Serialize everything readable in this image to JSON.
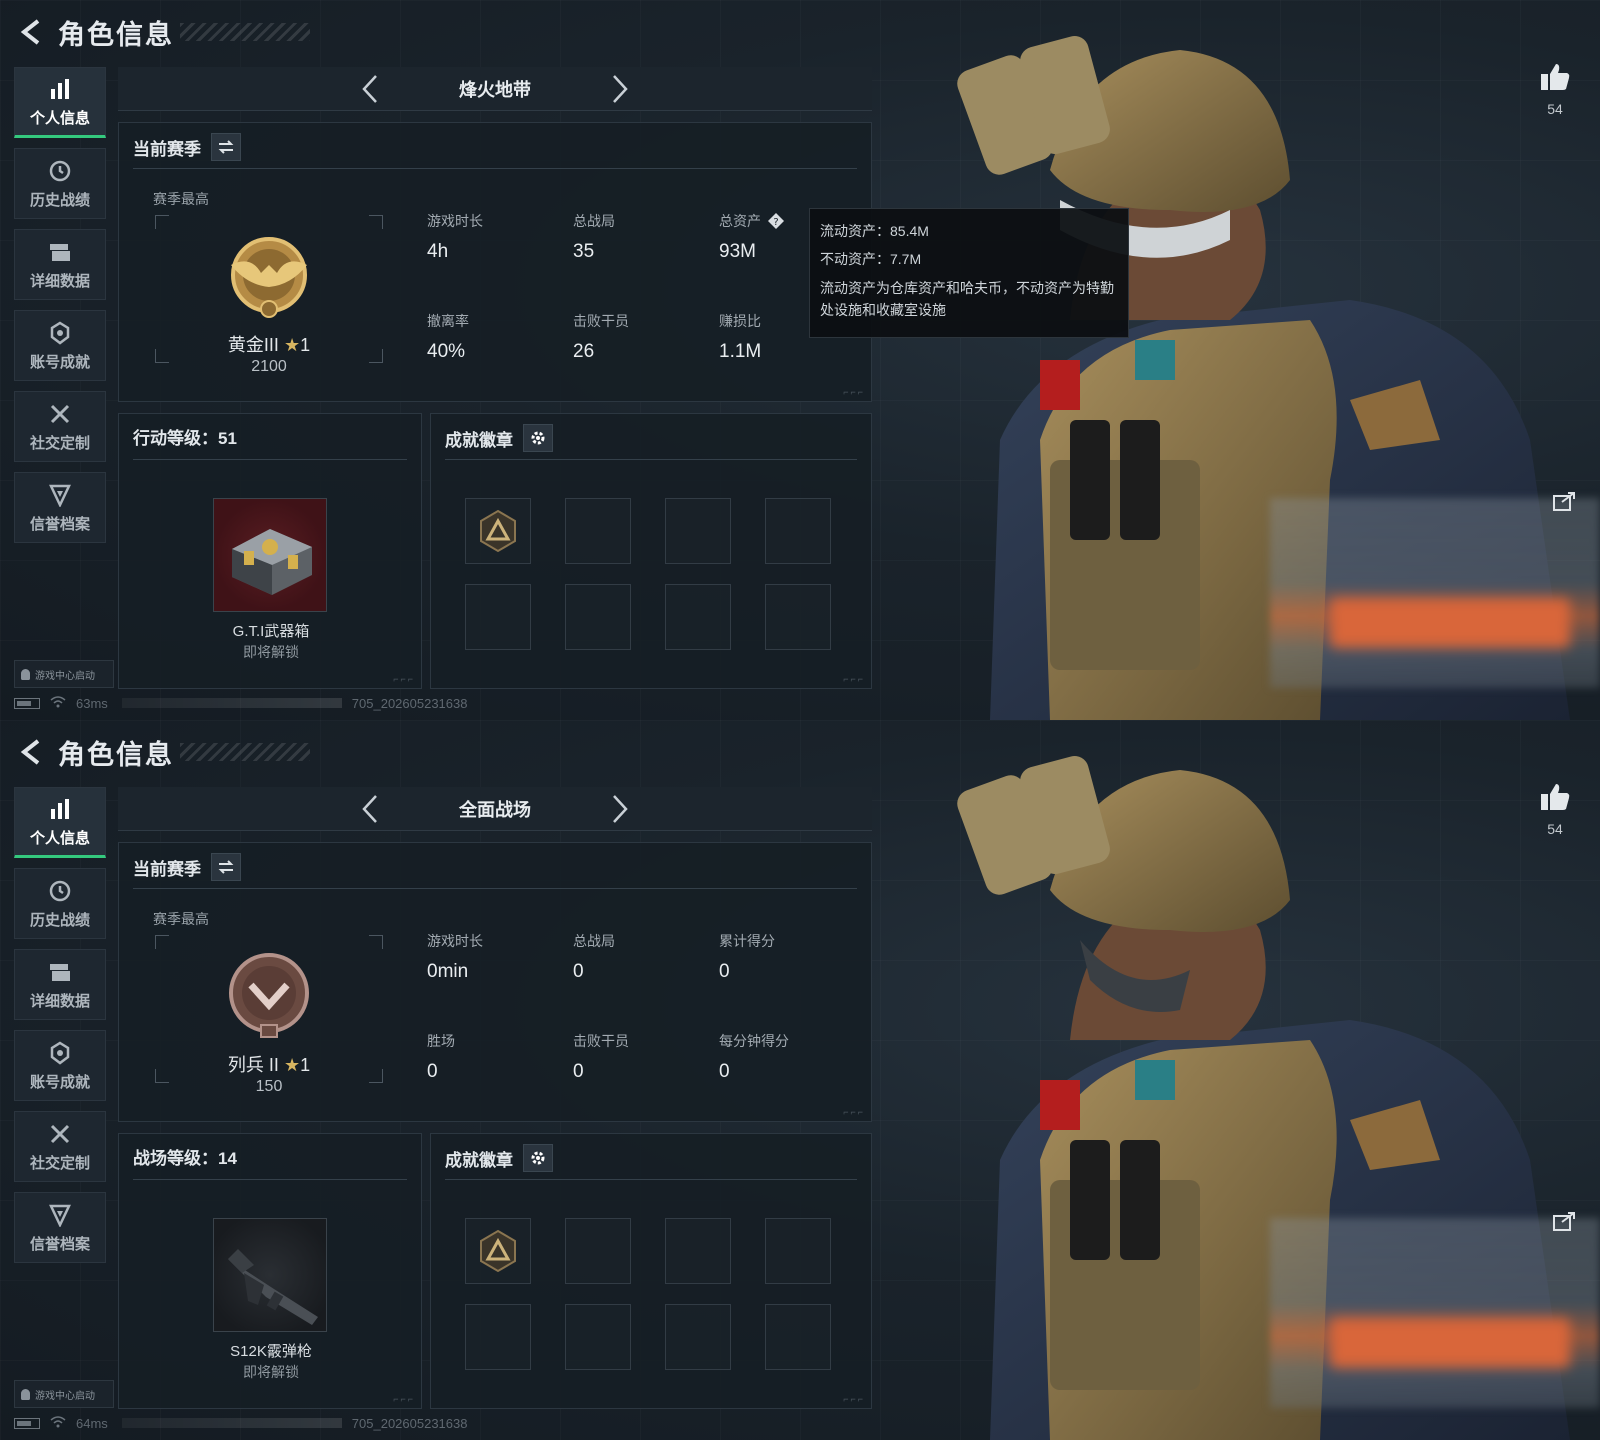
{
  "screens": [
    {
      "header": {
        "title": "角色信息"
      },
      "sidebar": {
        "items": [
          {
            "label": "个人信息",
            "icon": "bar-chart-icon",
            "active": true
          },
          {
            "label": "历史战绩",
            "icon": "clock-icon"
          },
          {
            "label": "详细数据",
            "icon": "folder-icon"
          },
          {
            "label": "账号成就",
            "icon": "medal-icon"
          },
          {
            "label": "社交定制",
            "icon": "tools-icon"
          },
          {
            "label": "信誉档案",
            "icon": "shield-icon"
          }
        ],
        "launcher": "游戏中心启动"
      },
      "status": {
        "ping": "63ms",
        "build": "705_202605231638"
      },
      "mode": {
        "name": "烽火地带"
      },
      "season": {
        "title": "当前赛季",
        "best_label": "赛季最高",
        "rank_name": "黄金III",
        "rank_stars": "1",
        "rank_score": "2100",
        "stats": [
          {
            "label": "游戏时长",
            "value": "4h"
          },
          {
            "label": "总战局",
            "value": "35"
          },
          {
            "label": "总资产",
            "value": "93M",
            "has_help": true
          },
          {
            "label": "撤离率",
            "value": "40%"
          },
          {
            "label": "击败干员",
            "value": "26"
          },
          {
            "label": "赚损比",
            "value": "1.1M"
          }
        ]
      },
      "tooltip": {
        "line1": "流动资产：85.4M",
        "line2": "不动资产：7.7M",
        "desc": "流动资产为仓库资产和哈夫币，不动资产为特勤处设施和收藏室设施"
      },
      "level": {
        "title": "行动等级：51",
        "reward_name": "G.T.I武器箱",
        "reward_status": "即将解锁",
        "reward_type": "crate"
      },
      "badges": {
        "title": "成就徽章",
        "slots": 8,
        "filled": 1
      },
      "like_count": "54"
    },
    {
      "header": {
        "title": "角色信息"
      },
      "sidebar": {
        "items": [
          {
            "label": "个人信息",
            "icon": "bar-chart-icon",
            "active": true
          },
          {
            "label": "历史战绩",
            "icon": "clock-icon"
          },
          {
            "label": "详细数据",
            "icon": "folder-icon"
          },
          {
            "label": "账号成就",
            "icon": "medal-icon"
          },
          {
            "label": "社交定制",
            "icon": "tools-icon"
          },
          {
            "label": "信誉档案",
            "icon": "shield-icon"
          }
        ],
        "launcher": "游戏中心启动"
      },
      "status": {
        "ping": "64ms",
        "build": "705_202605231638"
      },
      "mode": {
        "name": "全面战场"
      },
      "season": {
        "title": "当前赛季",
        "best_label": "赛季最高",
        "rank_name": "列兵 II",
        "rank_stars": "1",
        "rank_score": "150",
        "stats": [
          {
            "label": "游戏时长",
            "value": "0min"
          },
          {
            "label": "总战局",
            "value": "0"
          },
          {
            "label": "累计得分",
            "value": "0"
          },
          {
            "label": "胜场",
            "value": "0"
          },
          {
            "label": "击败干员",
            "value": "0"
          },
          {
            "label": "每分钟得分",
            "value": "0"
          }
        ]
      },
      "level": {
        "title": "战场等级：14",
        "reward_name": "S12K霰弹枪",
        "reward_status": "即将解锁",
        "reward_type": "gun"
      },
      "badges": {
        "title": "成就徽章",
        "slots": 8,
        "filled": 1
      },
      "like_count": "54"
    }
  ],
  "colors": {
    "accent_green": "#34c97e",
    "star_gold": "#d7b560",
    "panel_bg": "#161e25"
  }
}
